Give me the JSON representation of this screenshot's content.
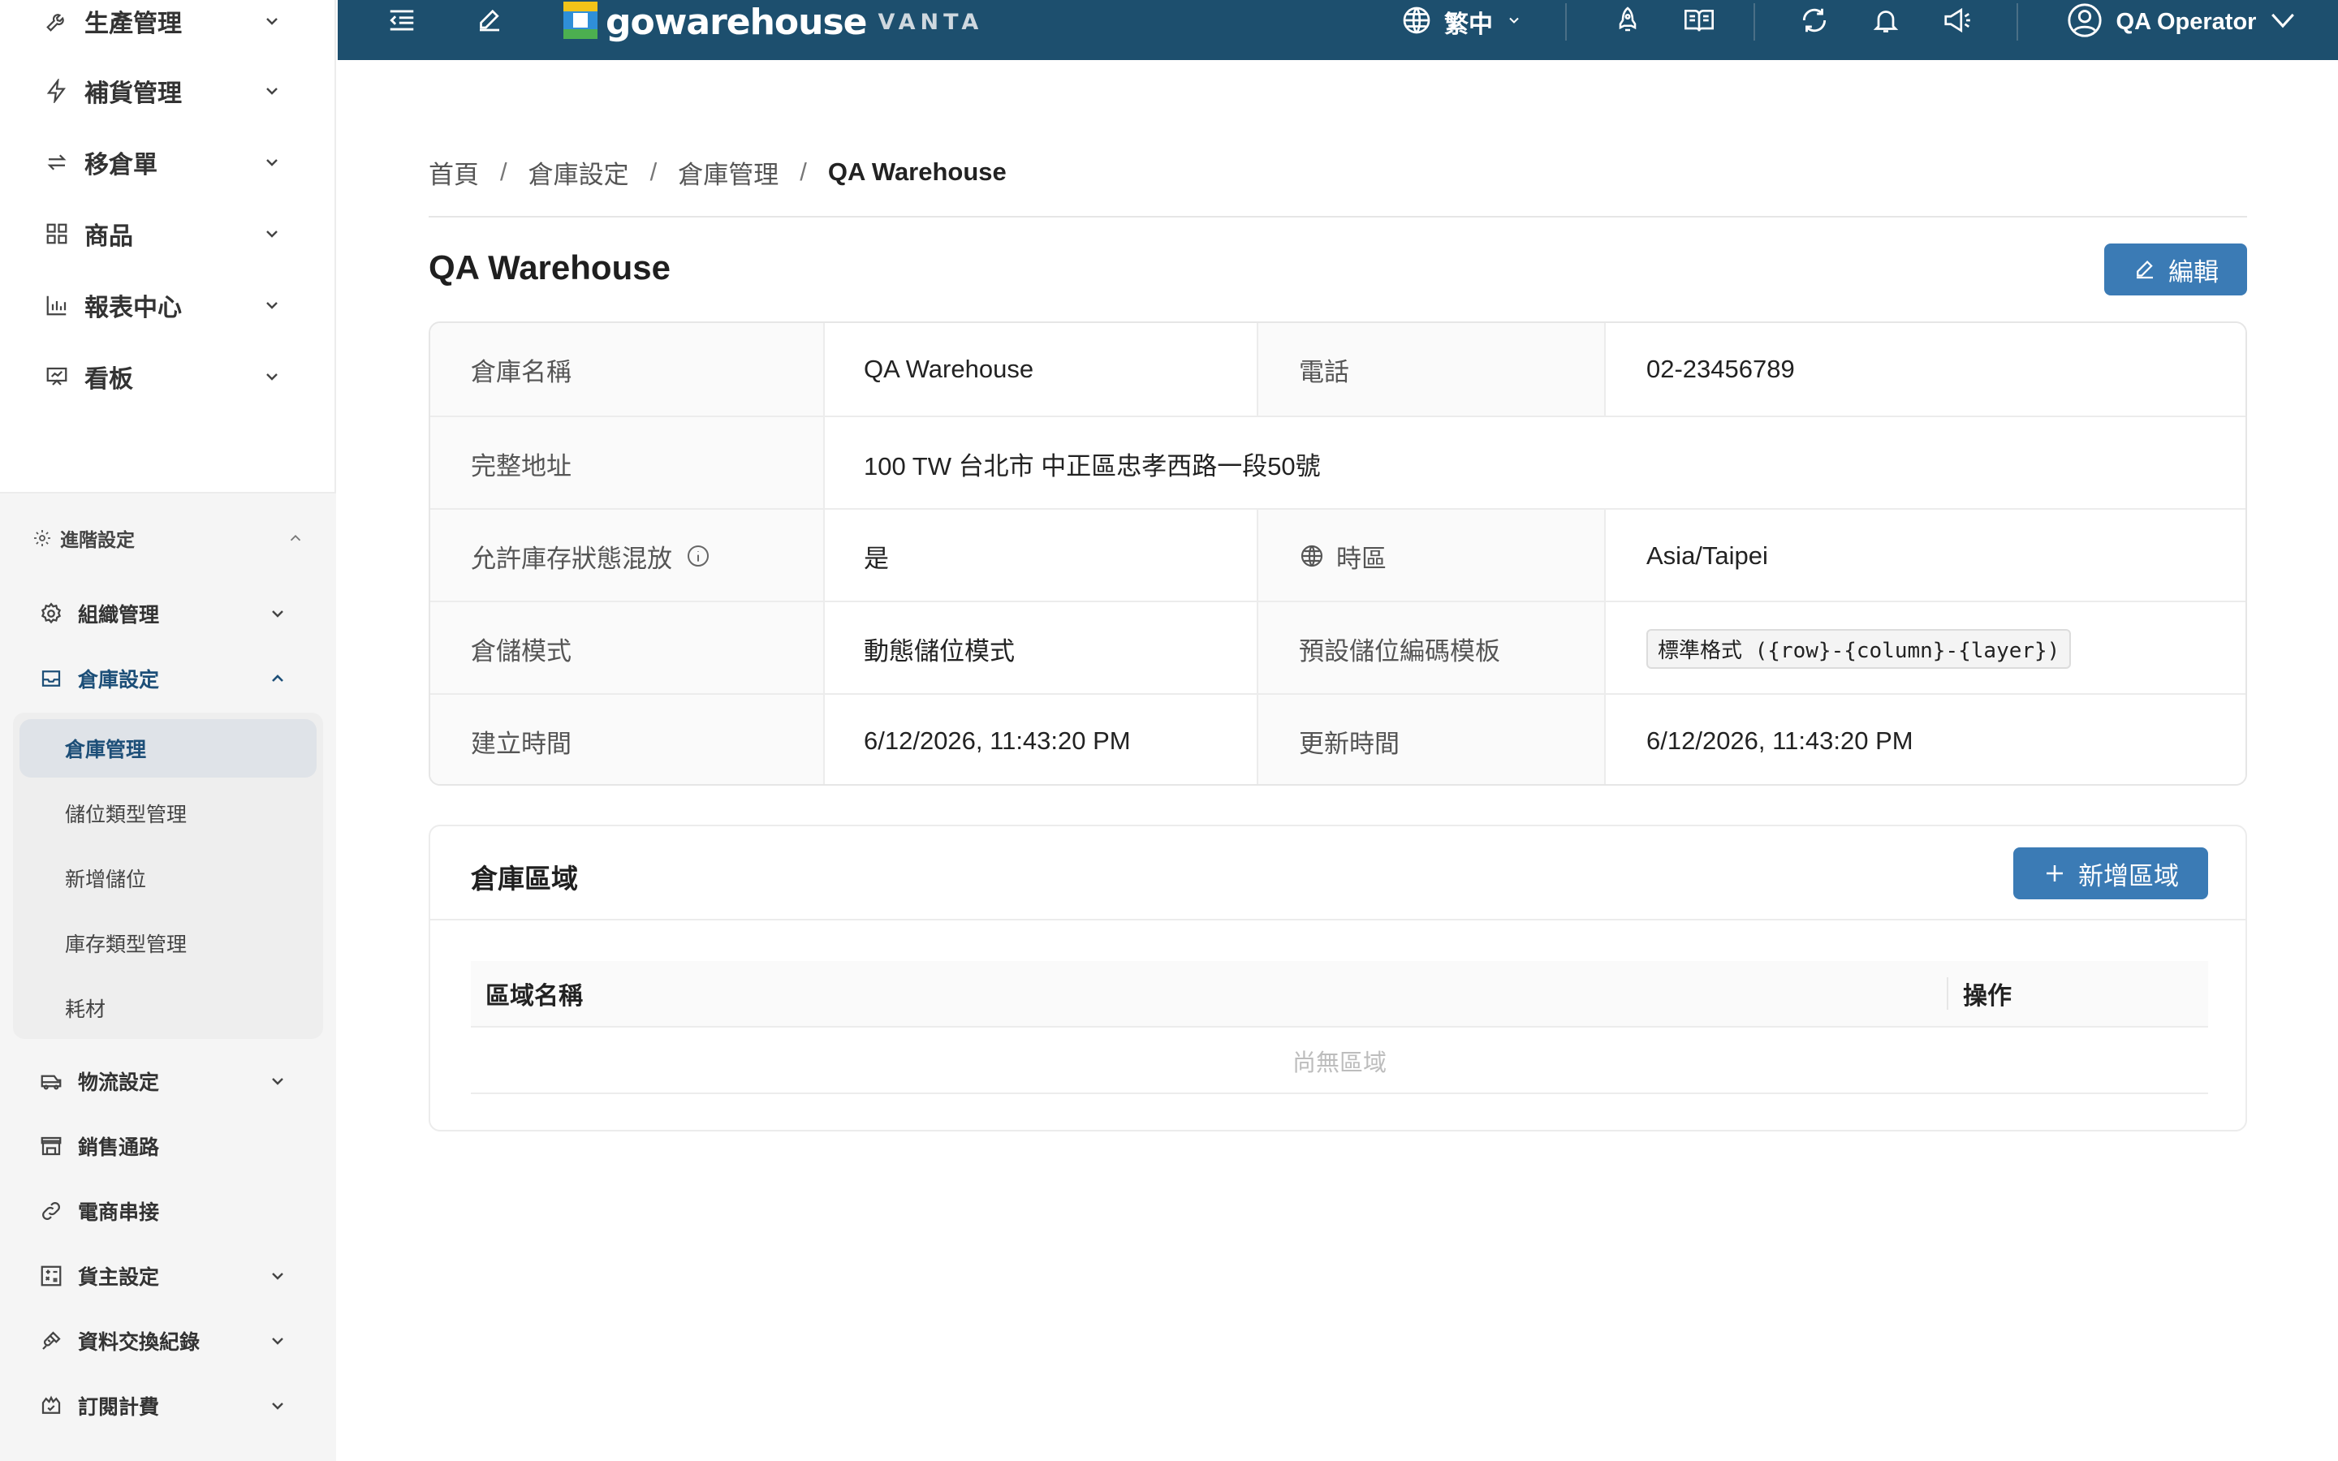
{
  "sidebar": {
    "top_items": [
      {
        "label": "生產管理",
        "icon": "wrench-icon"
      },
      {
        "label": "補貨管理",
        "icon": "lightning-icon"
      },
      {
        "label": "移倉單",
        "icon": "transfer-arrows-icon"
      },
      {
        "label": "商品",
        "icon": "grid-icon"
      },
      {
        "label": "報表中心",
        "icon": "bar-chart-icon"
      },
      {
        "label": "看板",
        "icon": "presentation-board-icon"
      }
    ],
    "advanced": {
      "label": "進階設定",
      "icon": "gear-icon",
      "items": [
        {
          "label": "組織管理",
          "icon": "gear-icon"
        },
        {
          "label": "倉庫設定",
          "icon": "inbox-icon"
        },
        {
          "label": "物流設定",
          "icon": "truck-icon"
        },
        {
          "label": "銷售通路",
          "icon": "store-icon"
        },
        {
          "label": "電商串接",
          "icon": "link-icon"
        },
        {
          "label": "貨主設定",
          "icon": "calculator-icon"
        },
        {
          "label": "資料交換紀錄",
          "icon": "api-plug-icon"
        },
        {
          "label": "訂閱計費",
          "icon": "subscription-icon"
        }
      ],
      "warehouse_children": [
        "倉庫管理",
        "儲位類型管理",
        "新增儲位",
        "庫存類型管理",
        "耗材"
      ],
      "active_child": "倉庫管理"
    }
  },
  "topbar": {
    "logo_word": "gowarehouse",
    "logo_sub": "VANTA",
    "language": "繁中",
    "user": "QA Operator",
    "bg_color": "#1d4f6e"
  },
  "breadcrumb": [
    "首頁",
    "倉庫設定",
    "倉庫管理",
    "QA Warehouse"
  ],
  "page": {
    "title": "QA Warehouse",
    "edit_label": "編輯"
  },
  "details": {
    "name_label": "倉庫名稱",
    "name_value": "QA Warehouse",
    "phone_label": "電話",
    "phone_value": "02-23456789",
    "address_label": "完整地址",
    "address_value": "100 TW 台北市 中正區忠孝西路一段50號",
    "mixed_label": "允許庫存狀態混放",
    "mixed_value": "是",
    "timezone_label": "時區",
    "timezone_value": "Asia/Taipei",
    "mode_label": "倉儲模式",
    "mode_value": "動態儲位模式",
    "template_label": "預設儲位編碼模板",
    "template_value": "標準格式 ({row}-{column}-{layer})",
    "created_label": "建立時間",
    "created_value": "6/12/2026, 11:43:20 PM",
    "updated_label": "更新時間",
    "updated_value": "6/12/2026, 11:43:20 PM"
  },
  "zones": {
    "title": "倉庫區域",
    "add_label": "新增區域",
    "columns": [
      "區域名稱",
      "操作"
    ],
    "empty_text": "尚無區域"
  },
  "colors": {
    "primary": "#3b7bb5",
    "active_text": "#1d4f78"
  }
}
